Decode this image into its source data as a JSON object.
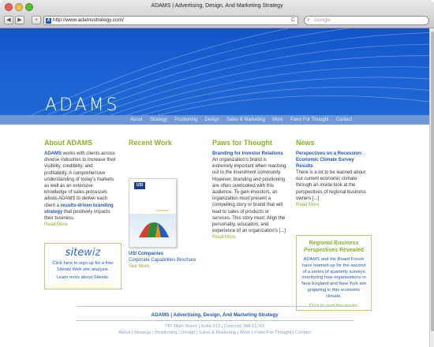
{
  "browser": {
    "title": "ADAMS | Advertising, Design, And Marketing Strategy",
    "back_label": "◀",
    "forward_label": "▶",
    "add_label": "+",
    "url": "http://www.adamsstrategy.com/",
    "reload_label": "C",
    "search_placeholder": "Google"
  },
  "site": {
    "logo": "ADAMS",
    "nav": [
      "About",
      "Strategy",
      "Positioning",
      "Design",
      "Sales & Marketing",
      "Work",
      "Paws For Thought",
      "Contact"
    ]
  },
  "about": {
    "heading": "About ADAMS",
    "brand": "ADAMS",
    "body_1": " works with clients across diverse industries to increase their visibility, credibility, and profitability. A comprehensive understanding of today's markets as well as an extensive knowledge of sales processes allows ADAMS to deliver each client a ",
    "bold_phrase": "results-driven branding strategy",
    "body_2": " that positively impacts their business.",
    "read_more": "Read More"
  },
  "sitewiz": {
    "brand_a": "site",
    "brand_b": "wiz",
    "line_1": "Click here to sign up for a free Sitewiz Web site analysis.",
    "line_2": "Learn more about Sitewiz."
  },
  "recent_work": {
    "heading": "Recent Work",
    "brochure_logo": "USI",
    "brochure_tag": "Solutions",
    "caption_title": "USI Companies",
    "caption_sub": "Corporate Capabilities Brochure",
    "see_more": "See More"
  },
  "paws": {
    "heading": "Paws for Thought",
    "headline": "Branding for Investor Relations",
    "body": "An organization's brand is extremely important when reaching out to the investment community. However, branding and positioning are often overlooked with this audience. To gain investors, an organization must present a compelling story or brand that will lead to sales of products or services. This story must: Align the personality, education, and experience of an organization's [...]",
    "read_more": "Read More"
  },
  "news": {
    "heading": "News",
    "headline": "Perspectives on a Recession: Economic Climate Survey Results",
    "body": "There is a lot to be learned about our current economic climate through an inside look at the perspectives of regional business owners [...]",
    "read_more": "Read More"
  },
  "regional": {
    "heading": "Regional Business Perspectives Revealed",
    "body": "ADAMS and the Board Forum have teamed up for the second of a series of quarterly surveys monitoring how organizations in New England and New York are grappling in this economic climate.",
    "cta": "Click to read the results."
  },
  "footer": {
    "title": "ADAMS | Advertising, Design, And Marketing Strategy",
    "address": "747 Main Street | Suite 312 | Concord, MA 01742",
    "links": "About | Strategy | Positioning | Design | Sales & Marketing | Work | Paws For Thought | Contact"
  }
}
